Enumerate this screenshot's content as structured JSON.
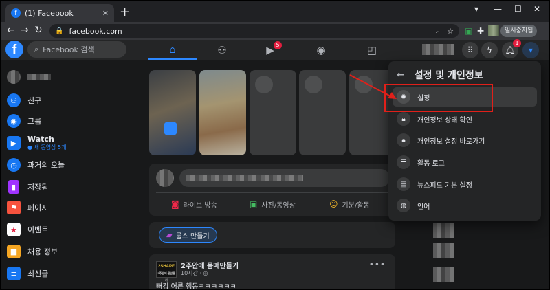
{
  "browser": {
    "tab_title": "(1) Facebook",
    "tab_favicon": "f",
    "tab_close": "✕",
    "new_tab": "+",
    "url": "facebook.com",
    "pause_label": "일시중지됨"
  },
  "fb_header": {
    "logo": "f",
    "search_placeholder": "Facebook 검색",
    "video_badge": "5",
    "notif_badge": "1"
  },
  "sidebar": {
    "items": [
      {
        "label": "친구",
        "icon": "friends-icon",
        "color": "#1877f2"
      },
      {
        "label": "그룹",
        "icon": "groups-icon",
        "color": "#1877f2"
      },
      {
        "label": "Watch",
        "sub": "● 새 동영상 5개",
        "icon": "watch-icon",
        "color": "#1877f2"
      },
      {
        "label": "과거의 오늘",
        "icon": "memories-icon",
        "color": "#1877f2"
      },
      {
        "label": "저장됨",
        "icon": "saved-icon",
        "color": "#a033ff"
      },
      {
        "label": "페이지",
        "icon": "pages-icon",
        "color": "#f7533e"
      },
      {
        "label": "이벤트",
        "icon": "events-icon",
        "color": "#e41e3f"
      },
      {
        "label": "채용 정보",
        "icon": "jobs-icon",
        "color": "#f5a623"
      },
      {
        "label": "최신글",
        "icon": "recent-icon",
        "color": "#1877f2"
      }
    ]
  },
  "composer": {
    "live": "라이브 방송",
    "photo": "사진/동영상",
    "feeling": "기분/활동"
  },
  "rooms": {
    "button": "룸스 만들기"
  },
  "post": {
    "page_logo": "2SHAPE",
    "page_logo_sub": "2주만에 몸만들기",
    "page_name": "2주안에 몸매만들기",
    "time": "10시간 · ◎",
    "body": "뻐킹 어른 행동ㅋㅋㅋㅋㅋㅋ"
  },
  "panel": {
    "title": "설정 및 개인정보",
    "items": [
      {
        "label": "설정",
        "icon": "gear-icon"
      },
      {
        "label": "개인정보 상태 확인",
        "icon": "lock-heart-icon"
      },
      {
        "label": "개인정보 설정 바로가기",
        "icon": "lock-icon"
      },
      {
        "label": "활동 로그",
        "icon": "list-icon"
      },
      {
        "label": "뉴스피드 기본 설정",
        "icon": "feed-icon"
      },
      {
        "label": "언어",
        "icon": "globe-icon"
      }
    ]
  },
  "colors": {
    "accent": "#2d88ff",
    "highlight_box": "#e0201a",
    "badge": "#e41e3f"
  }
}
